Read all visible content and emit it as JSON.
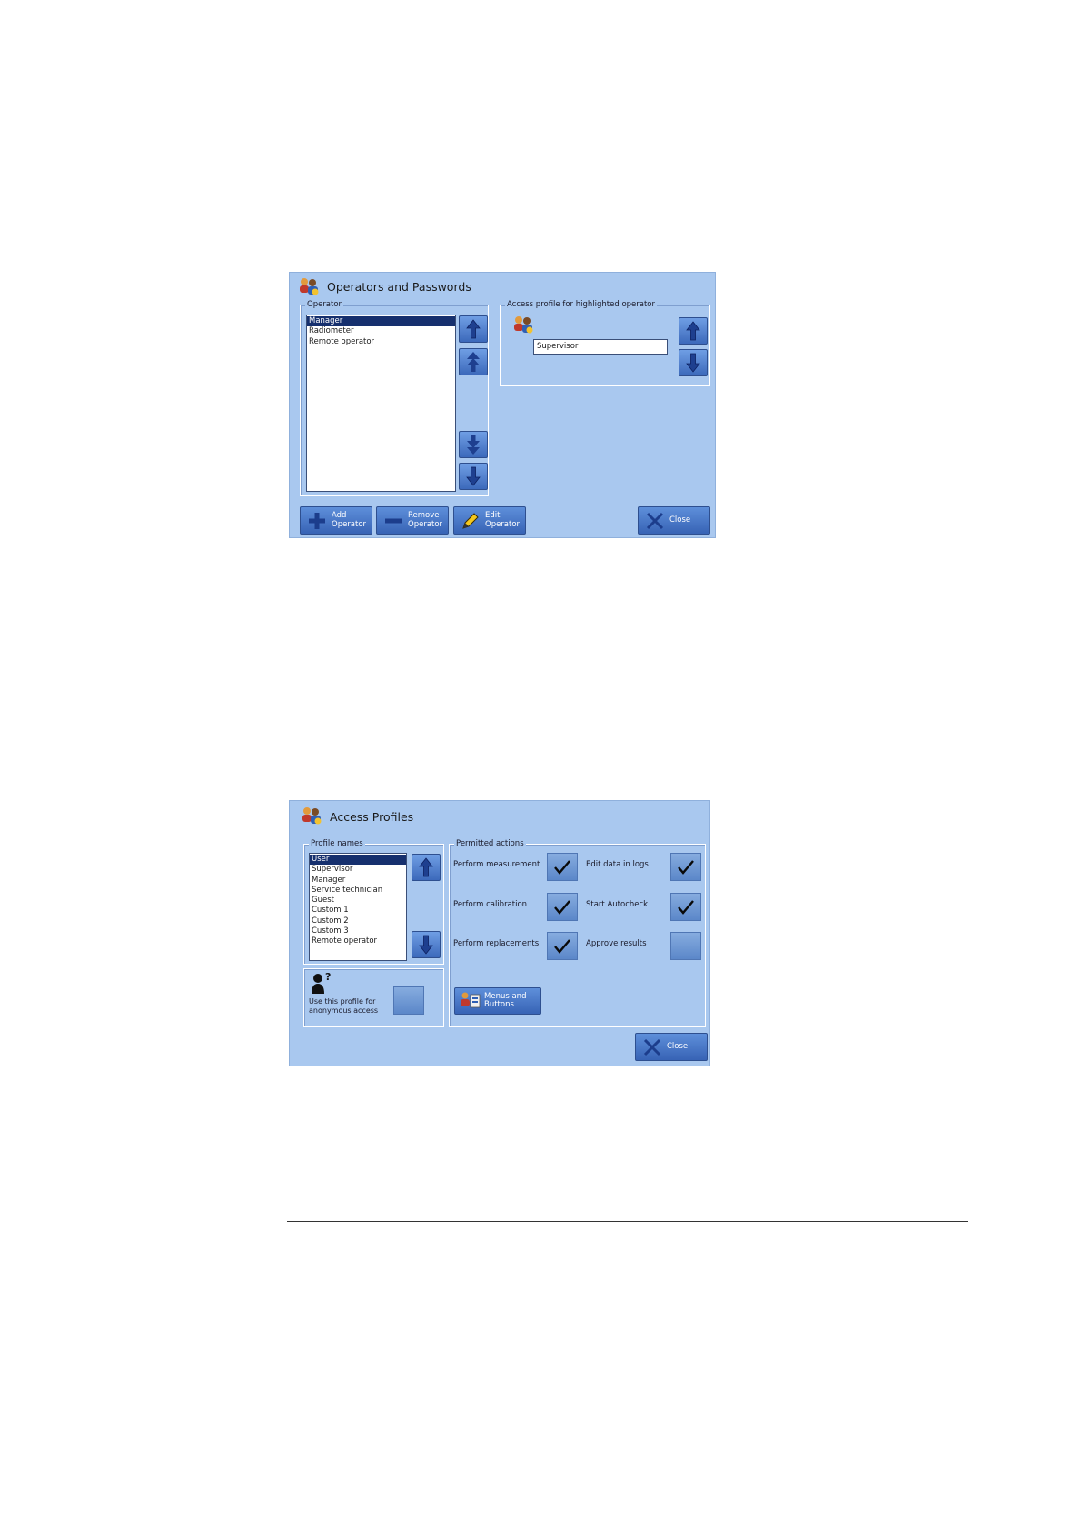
{
  "operators_window": {
    "title": "Operators and Passwords",
    "operator_group_label": "Operator",
    "operators": [
      "Manager",
      "Radiometer",
      "Remote operator"
    ],
    "selected_operator": "Manager",
    "access_group_label": "Access profile for highlighted operator",
    "profile_value": "Supervisor",
    "buttons": {
      "add": "Add\nOperator",
      "remove": "Remove\nOperator",
      "edit": "Edit\nOperator",
      "close": "Close"
    }
  },
  "access_window": {
    "title": "Access Profiles",
    "profile_group_label": "Profile names",
    "profiles": [
      "User",
      "Supervisor",
      "Manager",
      "Service technician",
      "Guest",
      "Custom 1",
      "Custom 2",
      "Custom 3",
      "Remote operator"
    ],
    "selected_profile": "User",
    "anonymous_label": "Use this profile for\nanonymous access",
    "anonymous_checked": false,
    "actions_group_label": "Permitted actions",
    "actions": [
      {
        "label": "Perform measurement",
        "checked": true
      },
      {
        "label": "Edit data in logs",
        "checked": true
      },
      {
        "label": "Perform calibration",
        "checked": true
      },
      {
        "label": "Start Autocheck",
        "checked": true
      },
      {
        "label": "Perform replacements",
        "checked": true
      },
      {
        "label": "Approve results",
        "checked": false
      }
    ],
    "menus_button": "Menus and\nButtons",
    "close_button": "Close"
  },
  "colors": {
    "window_bg": "#a9c8ef",
    "button": "#3c69bb",
    "selection": "#16306e"
  }
}
